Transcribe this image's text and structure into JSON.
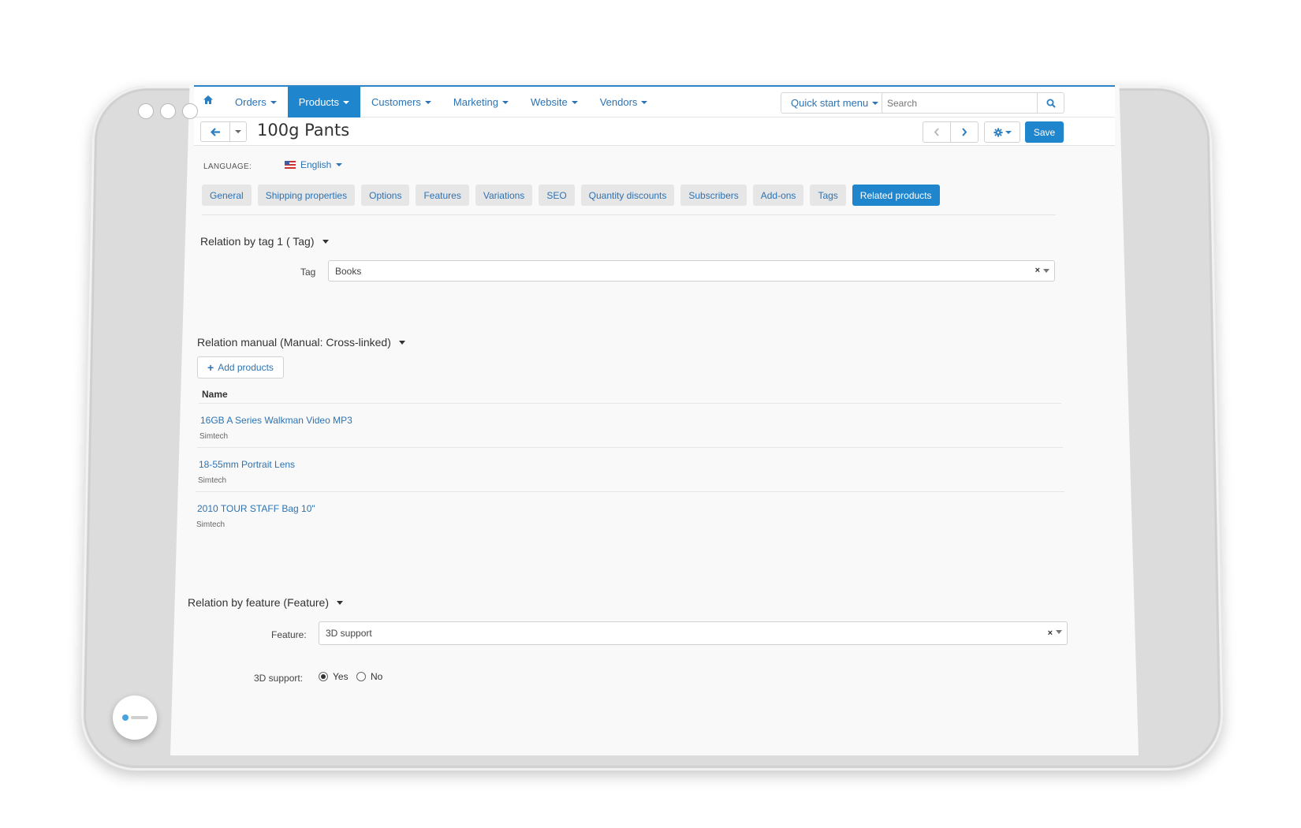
{
  "nav": {
    "items": [
      {
        "label": "Orders",
        "active": false
      },
      {
        "label": "Products",
        "active": true
      },
      {
        "label": "Customers",
        "active": false
      },
      {
        "label": "Marketing",
        "active": false
      },
      {
        "label": "Website",
        "active": false
      },
      {
        "label": "Vendors",
        "active": false
      }
    ],
    "quick_start_label": "Quick start menu",
    "search_placeholder": "Search"
  },
  "toolbar": {
    "page_title": "100g Pants",
    "save_label": "Save"
  },
  "language": {
    "label": "LANGUAGE:",
    "value": "English"
  },
  "tabs": [
    {
      "label": "General",
      "active": false
    },
    {
      "label": "Shipping properties",
      "active": false
    },
    {
      "label": "Options",
      "active": false
    },
    {
      "label": "Features",
      "active": false
    },
    {
      "label": "Variations",
      "active": false
    },
    {
      "label": "SEO",
      "active": false
    },
    {
      "label": "Quantity discounts",
      "active": false
    },
    {
      "label": "Subscribers",
      "active": false
    },
    {
      "label": "Add-ons",
      "active": false
    },
    {
      "label": "Tags",
      "active": false
    },
    {
      "label": "Related products",
      "active": true
    }
  ],
  "relation_tag": {
    "title": "Relation by tag 1 ( Tag)",
    "field_label": "Tag",
    "value": "Books"
  },
  "relation_manual": {
    "title": "Relation manual (Manual: Cross-linked)",
    "add_label": "Add products",
    "column_name": "Name",
    "products": [
      {
        "name": "16GB A Series Walkman Video MP3",
        "vendor": "Simtech"
      },
      {
        "name": "18-55mm Portrait Lens",
        "vendor": "Simtech"
      },
      {
        "name": "2010 TOUR STAFF Bag 10\"",
        "vendor": "Simtech"
      }
    ]
  },
  "relation_feature": {
    "title": "Relation by feature (Feature)",
    "field_label": "Feature:",
    "value": "3D support",
    "option_label": "3D support:",
    "yes_label": "Yes",
    "no_label": "No",
    "selected": "Yes"
  },
  "icons": {
    "home": "home-icon",
    "back": "arrow-left-icon",
    "prev": "chevron-left-icon",
    "next": "chevron-right-icon",
    "gear": "gear-icon",
    "search": "search-icon",
    "add": "plus-icon"
  },
  "colors": {
    "accent": "#1f85cd",
    "link": "#2d73b3"
  }
}
